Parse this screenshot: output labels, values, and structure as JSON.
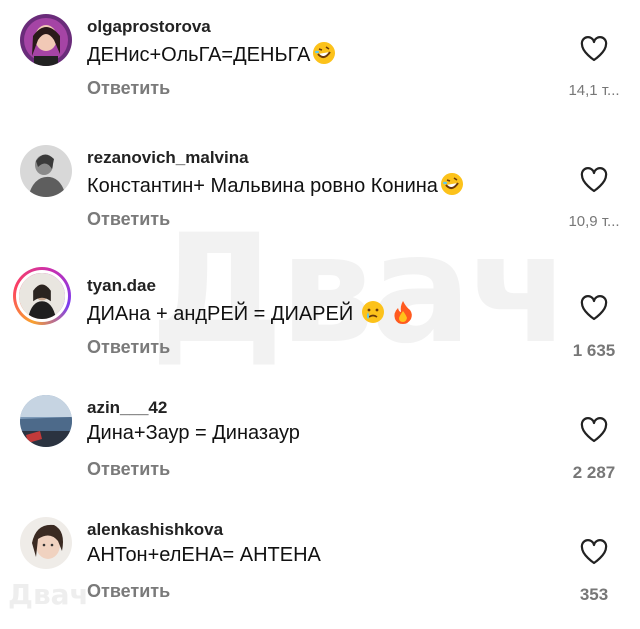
{
  "watermark": "Двач",
  "watermark_corner": "Двач",
  "comments": [
    {
      "username": "olgaprostorova",
      "text": "ДЕНис+ОльГА=ДЕНЬГА",
      "reply_label": "Ответить",
      "likes": "14,1 т...",
      "emoji": [
        "rofl"
      ],
      "has_story_ring": false
    },
    {
      "username": "rezanovich_malvina",
      "text": "Константин+ Мальвина ровно Конина",
      "reply_label": "Ответить",
      "likes": "10,9 т...",
      "emoji": [
        "rofl"
      ],
      "has_story_ring": false
    },
    {
      "username": "tyan.dae",
      "text": "ДИАна + андРЕЙ = ДИАРЕЙ",
      "reply_label": "Ответить",
      "likes": "1 635",
      "emoji": [
        "crying-face",
        "fire"
      ],
      "has_story_ring": true
    },
    {
      "username": "azin___42",
      "text": "Дина+Заур = Диназаур",
      "reply_label": "Ответить",
      "likes": "2 287",
      "emoji": [],
      "has_story_ring": false
    },
    {
      "username": "alenkashishkova",
      "text": "АНТон+елЕНА= АНТЕНА",
      "reply_label": "Ответить",
      "likes": "353",
      "emoji": [],
      "has_story_ring": false
    }
  ],
  "colors": {
    "secondary_text": "#7a7a7a",
    "story_ring": "#fc3f62"
  }
}
